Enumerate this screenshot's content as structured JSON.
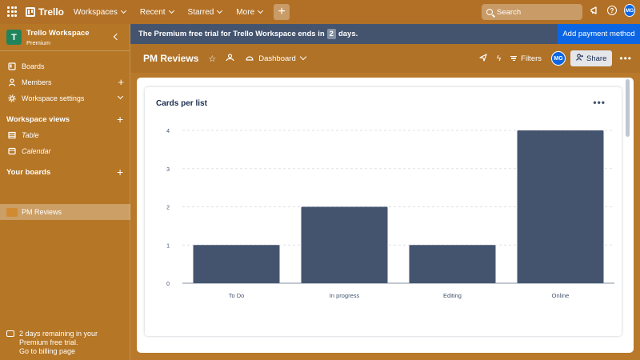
{
  "topnav": {
    "logo": "Trello",
    "menu": [
      "Workspaces",
      "Recent",
      "Starred",
      "More"
    ],
    "search_placeholder": "Search",
    "avatar": "MG"
  },
  "sidebar": {
    "workspace_name": "Trello Workspace",
    "workspace_plan": "Premium",
    "workspace_initial": "T",
    "items": {
      "boards": "Boards",
      "members": "Members",
      "settings": "Workspace settings"
    },
    "views_title": "Workspace views",
    "views": {
      "table": "Table",
      "calendar": "Calendar"
    },
    "your_boards_title": "Your boards",
    "board": "PM Reviews",
    "trial_line1": "2 days remaining in your",
    "trial_line2": "Premium free trial.",
    "trial_line3": "Go to billing page"
  },
  "banner": {
    "text_before": "The Premium free trial for Trello Workspace ends in",
    "days": "2",
    "text_after": "days.",
    "button": "Add payment method"
  },
  "board_header": {
    "title": "PM Reviews",
    "view": "Dashboard",
    "filters": "Filters",
    "avatar": "MG",
    "share": "Share"
  },
  "panel": {
    "title": "Cards per list"
  },
  "colors": {
    "bar": "#44546f",
    "accent": "#0c66e4"
  },
  "chart_data": {
    "type": "bar",
    "title": "Cards per list",
    "categories": [
      "To Do",
      "In progress",
      "Editing",
      "Online"
    ],
    "values": [
      1,
      2,
      1,
      4
    ],
    "yticks": [
      0,
      1,
      2,
      3,
      4
    ],
    "ylim": [
      0,
      4
    ],
    "grid": true
  }
}
